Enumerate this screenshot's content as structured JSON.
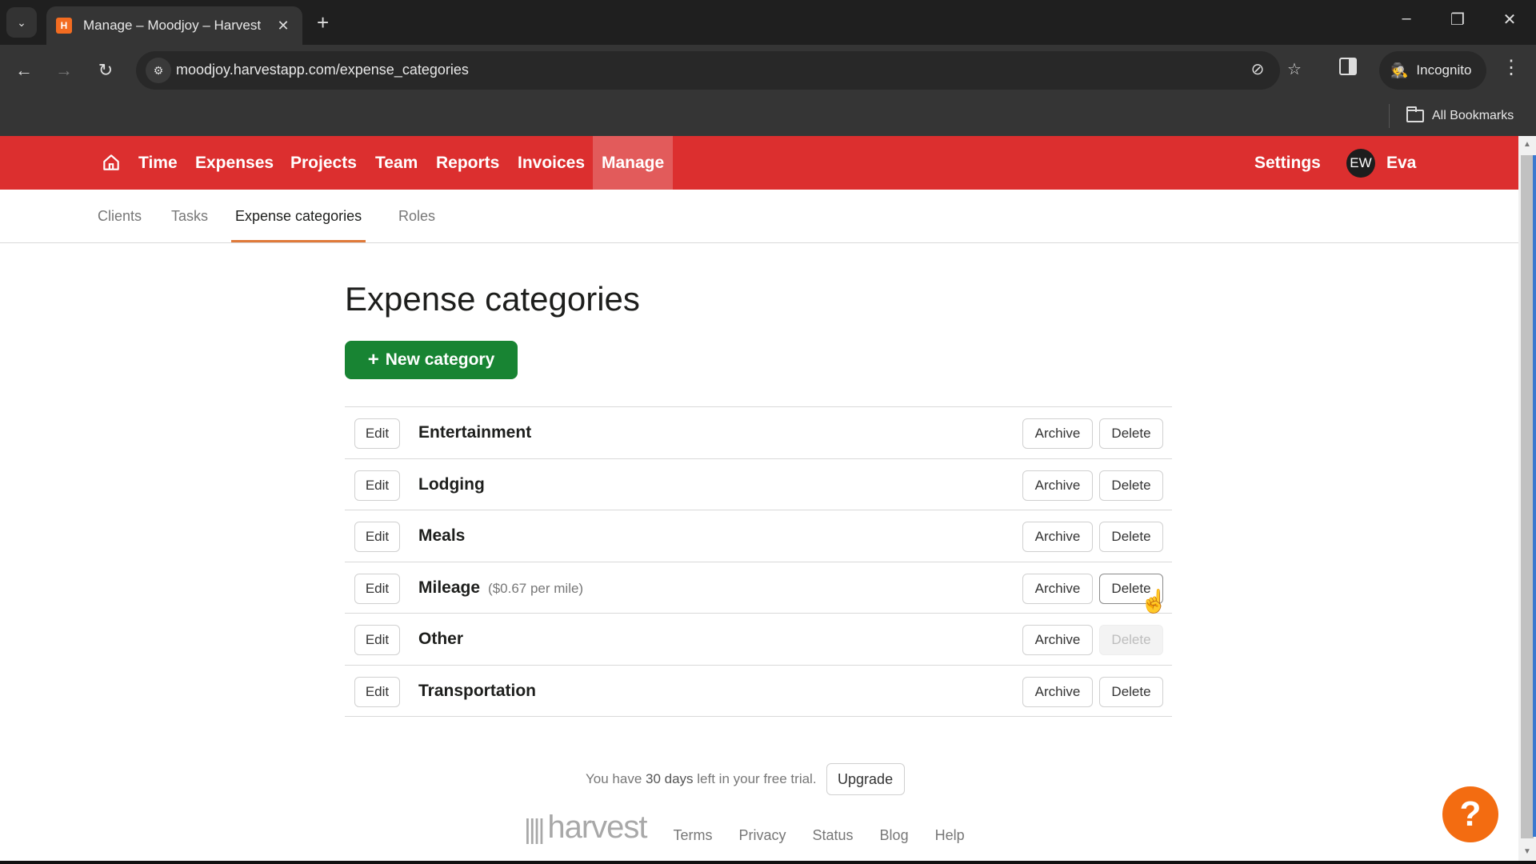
{
  "browser": {
    "tab_title": "Manage – Moodjoy – Harvest",
    "tab_favicon": "H",
    "url": "moodjoy.harvestapp.com/expense_categories",
    "incognito_label": "Incognito",
    "bookmarks_label": "All Bookmarks",
    "icons": {
      "tab_search": "⌄",
      "close": "✕",
      "new_tab": "+",
      "minimize": "–",
      "restore": "❐",
      "window_close": "✕",
      "back": "←",
      "forward": "→",
      "reload": "↻",
      "site_info": "⚙",
      "eye_off": "⊘",
      "star": "☆",
      "incognito": "🕵",
      "menu": "⋮"
    }
  },
  "nav": {
    "items": [
      {
        "label": "Time"
      },
      {
        "label": "Expenses"
      },
      {
        "label": "Projects"
      },
      {
        "label": "Team"
      },
      {
        "label": "Reports"
      },
      {
        "label": "Invoices"
      },
      {
        "label": "Manage",
        "active": true
      }
    ],
    "settings_label": "Settings",
    "user_initials": "EW",
    "user_name": "Eva",
    "brand_color": "#dc2f2f"
  },
  "subnav": {
    "items": [
      {
        "label": "Clients"
      },
      {
        "label": "Tasks"
      },
      {
        "label": "Expense categories",
        "active": true
      },
      {
        "label": "Roles"
      }
    ]
  },
  "page": {
    "title": "Expense categories",
    "new_button_label": "New category",
    "new_button_icon": "+",
    "edit_label": "Edit",
    "archive_label": "Archive",
    "delete_label": "Delete",
    "categories": [
      {
        "name": "Entertainment",
        "note": "",
        "delete_state": "enabled"
      },
      {
        "name": "Lodging",
        "note": "",
        "delete_state": "enabled"
      },
      {
        "name": "Meals",
        "note": "",
        "delete_state": "enabled"
      },
      {
        "name": "Mileage",
        "note": "($0.67 per mile)",
        "delete_state": "hover"
      },
      {
        "name": "Other",
        "note": "",
        "delete_state": "disabled"
      },
      {
        "name": "Transportation",
        "note": "",
        "delete_state": "enabled"
      }
    ]
  },
  "footer": {
    "trial_prefix": "You have ",
    "trial_days": "30 days",
    "trial_suffix": " left in your free trial.",
    "upgrade_label": "Upgrade",
    "logo_mark": "||||",
    "logo_text": "harvest",
    "links": [
      "Terms",
      "Privacy",
      "Status",
      "Blog",
      "Help"
    ]
  },
  "help_button": {
    "label": "?"
  }
}
